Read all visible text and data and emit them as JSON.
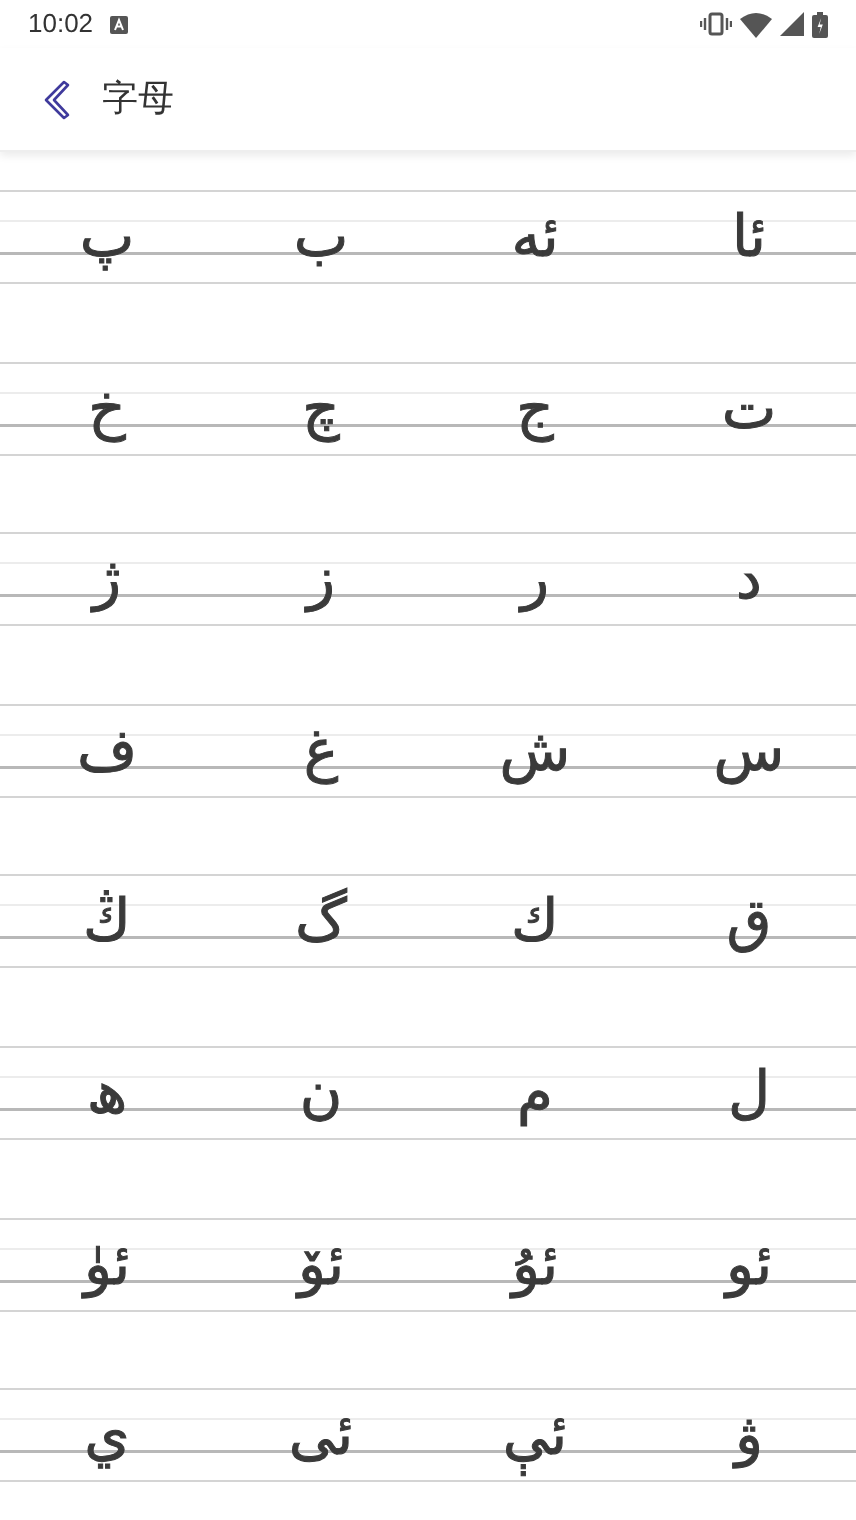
{
  "status_bar": {
    "time": "10:02"
  },
  "header": {
    "title": "字母"
  },
  "rows": [
    {
      "letters": [
        "ئا",
        "ئە",
        "ب",
        "پ"
      ]
    },
    {
      "letters": [
        "ت",
        "ج",
        "چ",
        "خ"
      ]
    },
    {
      "letters": [
        "د",
        "ر",
        "ز",
        "ژ"
      ]
    },
    {
      "letters": [
        "س",
        "ش",
        "غ",
        "ف"
      ]
    },
    {
      "letters": [
        "ق",
        "ك",
        "گ",
        "ڭ"
      ]
    },
    {
      "letters": [
        "ل",
        "م",
        "ن",
        "ھ"
      ]
    },
    {
      "letters": [
        "ئو",
        "ئۇ",
        "ئۆ",
        "ئۈ"
      ]
    },
    {
      "letters": [
        "ۋ",
        "ئې",
        "ئى",
        "ي"
      ]
    }
  ]
}
